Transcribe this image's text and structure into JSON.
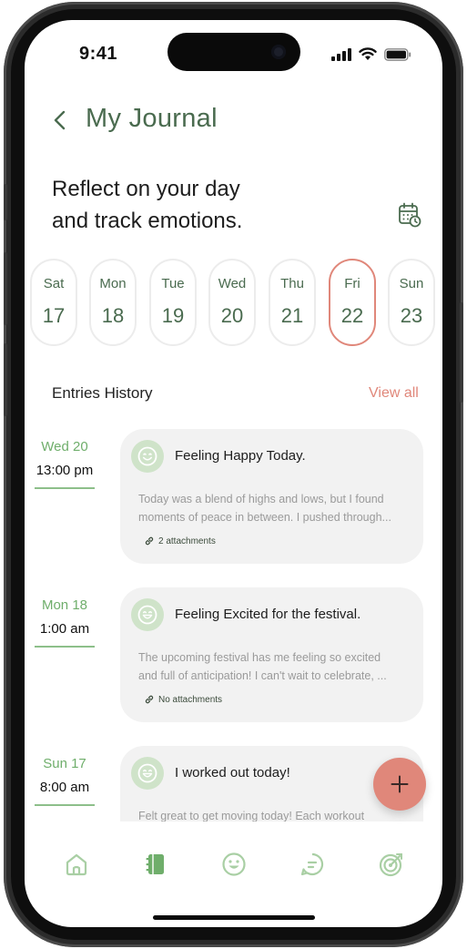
{
  "status": {
    "time": "9:41"
  },
  "header": {
    "title": "My Journal"
  },
  "reflect": {
    "line1": "Reflect on your day",
    "line2": "and track emotions."
  },
  "days": [
    {
      "name": "Sat",
      "num": "17",
      "selected": false
    },
    {
      "name": "Mon",
      "num": "18",
      "selected": false
    },
    {
      "name": "Tue",
      "num": "19",
      "selected": false
    },
    {
      "name": "Wed",
      "num": "20",
      "selected": false
    },
    {
      "name": "Thu",
      "num": "21",
      "selected": false
    },
    {
      "name": "Fri",
      "num": "22",
      "selected": true
    },
    {
      "name": "Sun",
      "num": "23",
      "selected": false
    }
  ],
  "entries_header": {
    "label": "Entries History",
    "view_all": "View all"
  },
  "entries": [
    {
      "day": "Wed 20",
      "time": "13:00 pm",
      "mood": "happy-face-icon",
      "title": "Feeling Happy Today.",
      "line1": "Today was a blend of highs and lows, but I found",
      "line2": "moments of peace in between. I pushed through...",
      "attachments": "2 attachments"
    },
    {
      "day": "Mon 18",
      "time": "1:00 am",
      "mood": "excited-face-icon",
      "title": "Feeling Excited for the festival.",
      "line1": "The upcoming festival has me feeling so excited",
      "line2": " and full of anticipation! I can't wait to celebrate, ...",
      "attachments": "No attachments"
    },
    {
      "day": "Sun 17",
      "time": "8:00 am",
      "mood": "excited-face-icon",
      "title": "I worked out today!",
      "line1": "Felt great to get moving today! Each workout",
      "line2": "",
      "attachments": ""
    }
  ],
  "colors": {
    "accent_green": "#4a6b4f",
    "light_green": "#8dbf8a",
    "coral": "#e0877a",
    "card_bg": "#f2f2f2"
  },
  "nav": [
    "home-icon",
    "journal-icon",
    "mood-icon",
    "chat-icon",
    "goals-icon"
  ]
}
